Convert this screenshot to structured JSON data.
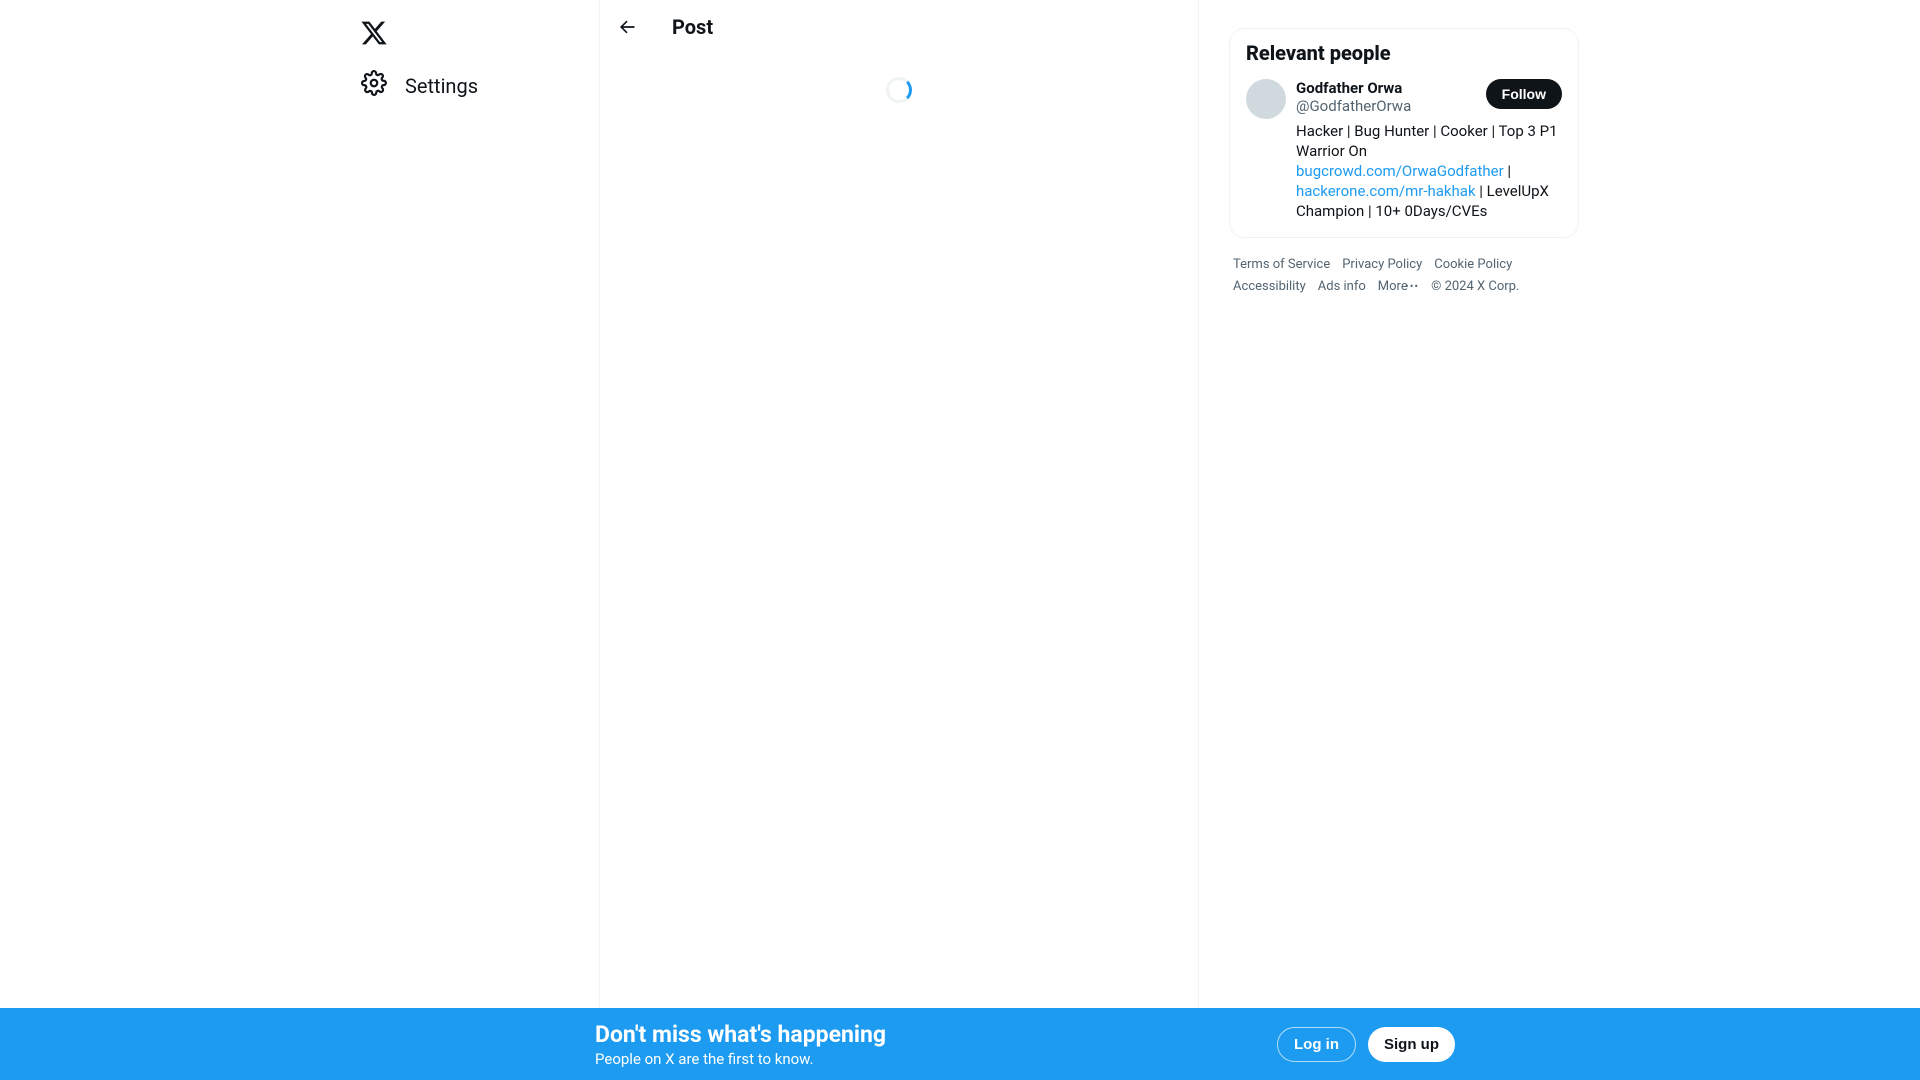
{
  "nav": {
    "settings_label": "Settings"
  },
  "header": {
    "title": "Post"
  },
  "relevant_people": {
    "title": "Relevant people",
    "person": {
      "name": "Godfather Orwa",
      "handle": "@GodfatherOrwa",
      "follow_label": "Follow",
      "bio_part1": "Hacker | Bug Hunter | Cooker | Top 3 P1 Warrior On ",
      "bio_link1": "bugcrowd.com/OrwaGodfather",
      "bio_sep1": " | ",
      "bio_link2": "hackerone.com/mr-hakhak",
      "bio_part2": " | LevelUpX Champion | 10+ 0Days/CVEs"
    }
  },
  "footer": {
    "links": {
      "terms": "Terms of Service",
      "privacy": "Privacy Policy",
      "cookie": "Cookie Policy",
      "accessibility": "Accessibility",
      "ads": "Ads info",
      "more": "More",
      "copyright": "© 2024 X Corp."
    }
  },
  "banner": {
    "headline": "Don't miss what's happening",
    "subline": "People on X are the first to know.",
    "login_label": "Log in",
    "signup_label": "Sign up"
  }
}
